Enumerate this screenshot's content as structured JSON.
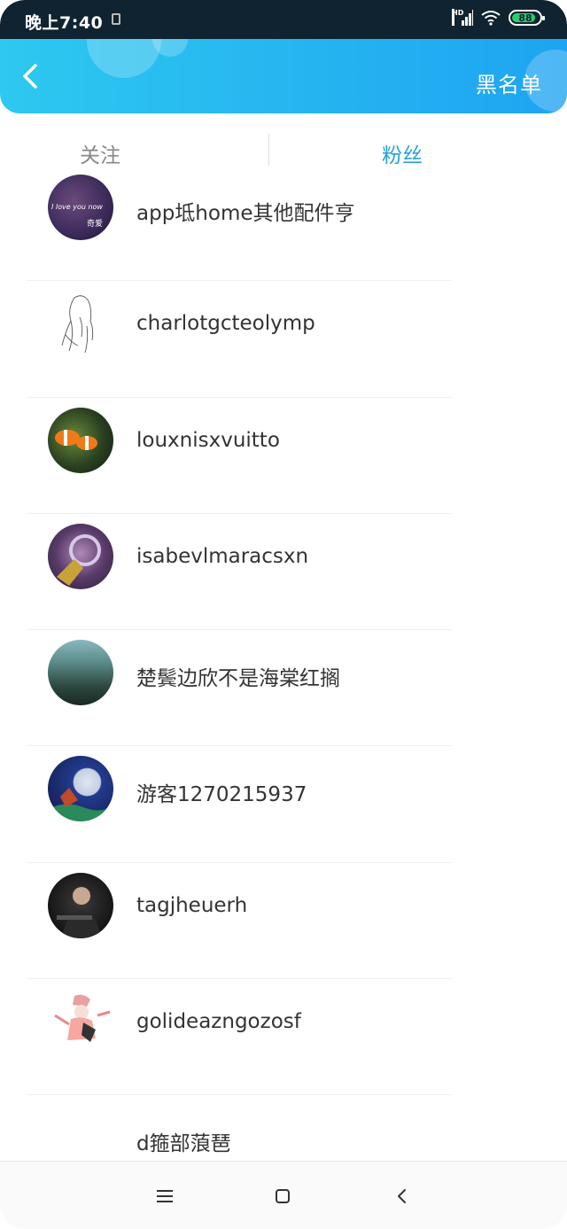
{
  "status_bar": {
    "time": "晚上7:40",
    "network": "HD",
    "battery": "88",
    "battery_level": 0.88
  },
  "header": {
    "back_icon": "chevron-left-icon",
    "title": "黑名单"
  },
  "tabs": [
    {
      "label": "关注",
      "active": false
    },
    {
      "label": "粉丝",
      "active": true
    }
  ],
  "fans": [
    {
      "name": "app坻home其他配件亨",
      "avatar_caption": "I love you now",
      "avatar_caption2": "奇爱"
    },
    {
      "name": "charlotgcteolymp"
    },
    {
      "name": "louxnisxvuitto"
    },
    {
      "name": "isabevlmaracsxn"
    },
    {
      "name": "楚鬓边欣不是海棠红搁"
    },
    {
      "name": "游客1270215937"
    },
    {
      "name": "tagjheuerh"
    },
    {
      "name": "golideazngozosf"
    },
    {
      "name": "d箍部蒗琶"
    }
  ],
  "nav_bar": {
    "menu_icon": "menu-icon",
    "home_icon": "home-square-icon",
    "back_icon": "back-triangle-icon"
  },
  "colors": {
    "header_gradient_start": "#2ec8f0",
    "header_gradient_end": "#1ea4f1",
    "active_tab": "#2aa0d8",
    "inactive_tab": "#888888"
  }
}
